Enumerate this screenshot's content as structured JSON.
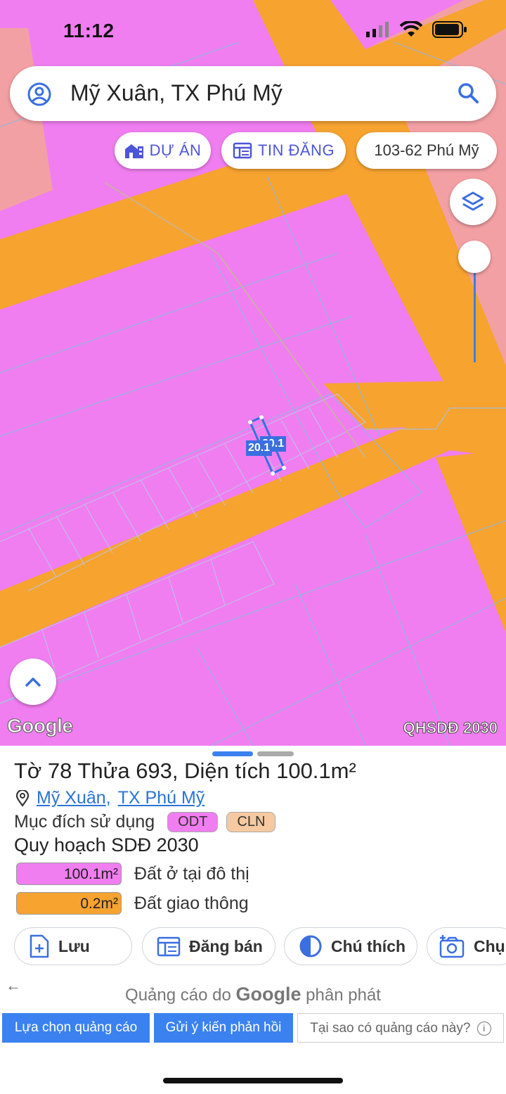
{
  "status_bar": {
    "time": "11:12"
  },
  "search": {
    "value": "Mỹ Xuân, TX Phú Mỹ"
  },
  "chips": [
    {
      "label": "DỰ ÁN",
      "icon": "building-icon"
    },
    {
      "label": "TIN ĐĂNG",
      "icon": "listing-icon"
    },
    {
      "label": "103-62 Phú Mỹ"
    }
  ],
  "map": {
    "attribution": "Google",
    "layer_tag": "QHSDĐ 2030",
    "plot_label_1": "20.1",
    "plot_label_2": "20.1",
    "zoom_fraction": 0.35,
    "colors": {
      "residential": "#f07ef0",
      "transport": "#f6a330",
      "other": "#f3a0a4"
    }
  },
  "sheet": {
    "title": "Tờ 78 Thửa 693, Diện tích 100.1m²",
    "location_ward": "Mỹ Xuân",
    "location_sep": ",",
    "location_town": "TX Phú Mỹ",
    "purpose_label": "Mục đích sử dụng",
    "purpose_tags": [
      {
        "code": "ODT",
        "color": "#f07ef0"
      },
      {
        "code": "CLN",
        "color": "#f6c9a0"
      }
    ],
    "plan_title": "Quy hoạch SDĐ 2030",
    "land_uses": [
      {
        "area": "100.1m²",
        "name": "Đất ở tại đô thị",
        "color": "#f07ef0"
      },
      {
        "area": "0.2m²",
        "name": "Đất giao thông",
        "color": "#f6a330"
      }
    ],
    "actions": [
      {
        "label": "Lưu",
        "icon": "save-add-icon"
      },
      {
        "label": "Đăng bán",
        "icon": "post-sale-icon"
      },
      {
        "label": "Chú thích",
        "icon": "legend-icon"
      },
      {
        "label": "Chụ",
        "icon": "camera-icon"
      }
    ]
  },
  "ads": {
    "prefix": "Quảng cáo do",
    "brand": "Google",
    "suffix": "phân phát",
    "buttons": [
      "Lựa chọn quảng cáo",
      "Gửi ý kiến phản hồi",
      "Tại sao có quảng cáo này?"
    ]
  }
}
